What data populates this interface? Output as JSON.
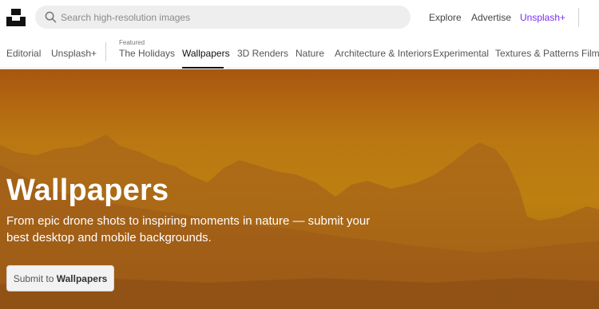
{
  "header": {
    "logo": "unsplash-logo",
    "search": {
      "placeholder": "Search high-resolution images",
      "value": "",
      "icon": "search-icon"
    },
    "nav": {
      "explore": "Explore",
      "advertise": "Advertise",
      "unsplash_plus": "Unsplash+"
    }
  },
  "tabs": {
    "editorial": "Editorial",
    "unsplash_plus": "Unsplash+",
    "featured_label": "Featured",
    "items": [
      "The Holidays",
      "Wallpapers",
      "3D Renders",
      "Nature",
      "Architecture & Interiors",
      "Experimental",
      "Textures & Patterns",
      "Film"
    ],
    "active": "Wallpapers"
  },
  "hero": {
    "title": "Wallpapers",
    "description": "From epic drone shots to inspiring moments in nature — submit your best desktop and mobile backgrounds.",
    "button_prefix": "Submit to ",
    "button_bold": "Wallpapers"
  },
  "colors": {
    "accent_plus": "#7b2ff7",
    "hero_orange": "#c4880f",
    "mountain": "#9c5a1a"
  }
}
